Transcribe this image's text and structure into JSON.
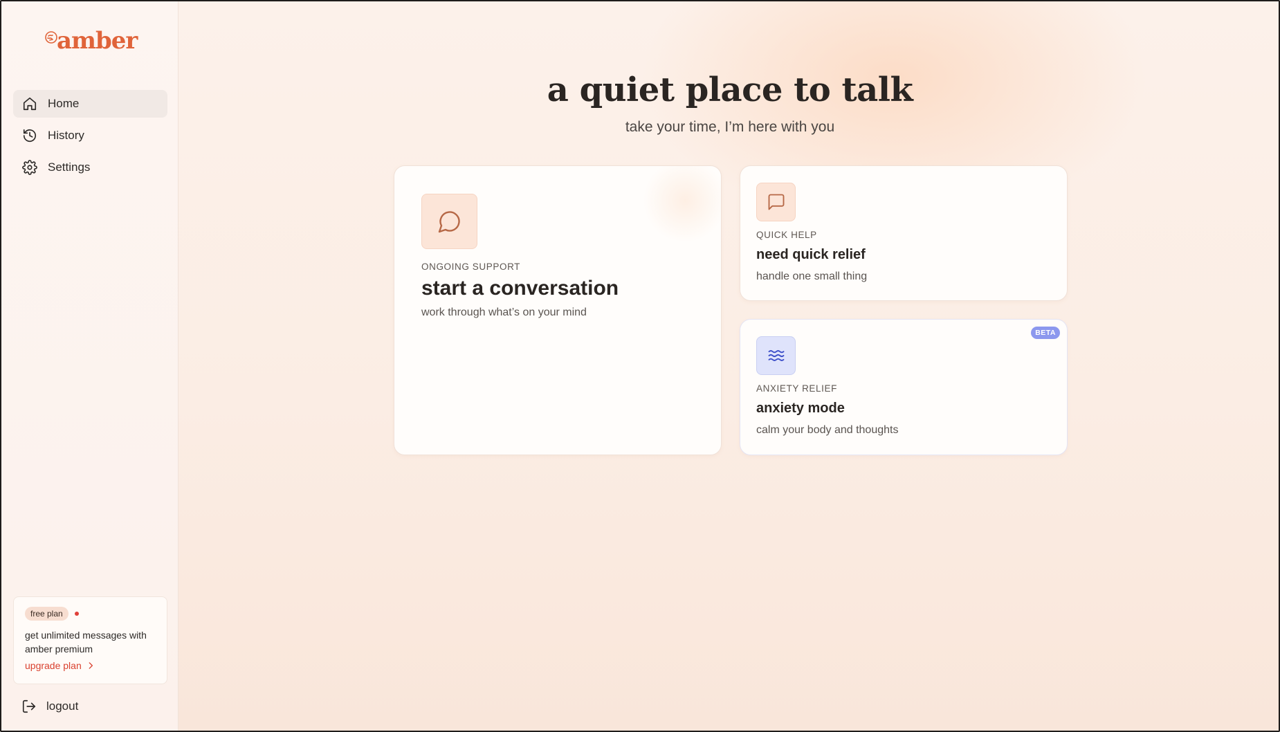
{
  "app": {
    "name": "amber"
  },
  "colors": {
    "brand": "#e0643a",
    "link": "#d9412f",
    "beta_badge": "#8c98ee"
  },
  "sidebar": {
    "items": [
      {
        "label": "Home",
        "icon": "home-icon",
        "active": true
      },
      {
        "label": "History",
        "icon": "history-icon",
        "active": false
      },
      {
        "label": "Settings",
        "icon": "gear-icon",
        "active": false
      }
    ],
    "plan": {
      "badge": "free plan",
      "text": "get unlimited messages with amber premium",
      "link": "upgrade plan"
    },
    "logout": "logout"
  },
  "main": {
    "title": "a quiet place to talk",
    "subtitle": "take your time, I’m here with you",
    "cards": {
      "conversation": {
        "eyebrow": "ONGOING SUPPORT",
        "title": "start a conversation",
        "desc": "work through what’s on your mind",
        "icon": "chat-bubble-icon"
      },
      "quick": {
        "eyebrow": "QUICK HELP",
        "title": "need quick relief",
        "desc": "handle one small thing",
        "icon": "message-square-icon"
      },
      "anxiety": {
        "eyebrow": "ANXIETY RELIEF",
        "title": "anxiety mode",
        "desc": "calm your body and thoughts",
        "icon": "waves-icon",
        "badge": "BETA"
      }
    }
  }
}
